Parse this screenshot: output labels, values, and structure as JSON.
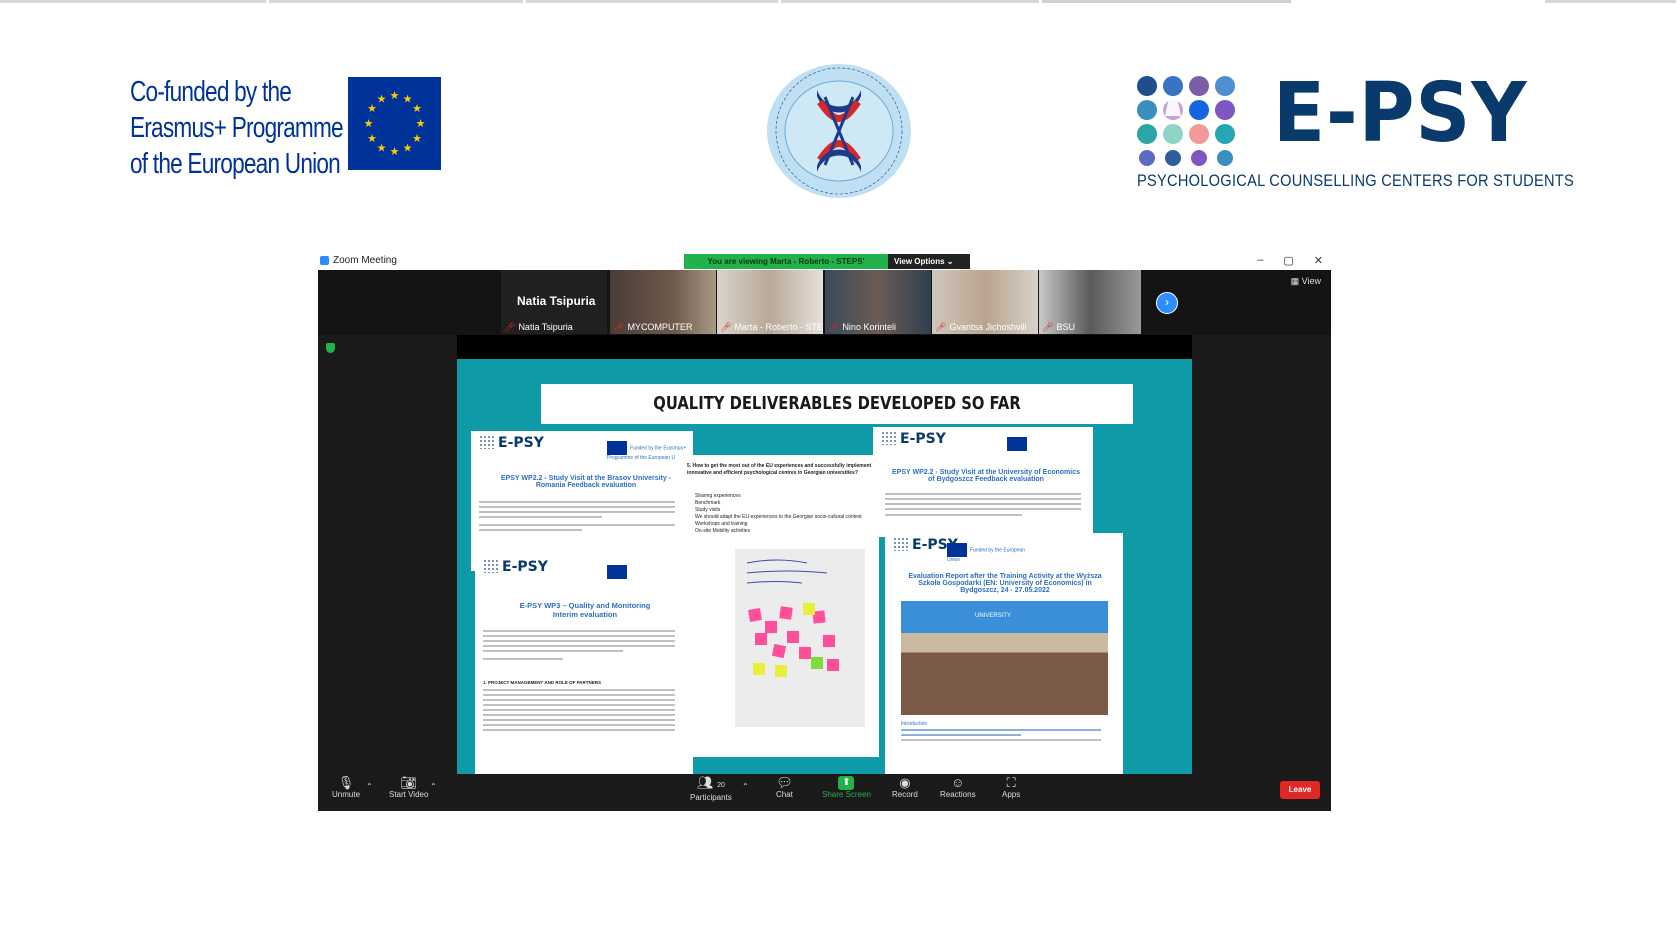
{
  "top_bar_colors": [
    "#d0d0d0",
    "#d0d0d0",
    "#d0d0d0",
    "#d0d0d0",
    "#cfcfcf",
    "#ffffff",
    "#d0d0d0"
  ],
  "eu_logo": {
    "lines": [
      "Co-funded by the",
      "Erasmus+ Programme",
      "of the European Union"
    ],
    "color": "#003399"
  },
  "university_seal": {
    "text": "Shota Meskhia State Teaching University of Zugdidi",
    "icon": "university-seal"
  },
  "epsy_logo": {
    "wordmark": "E-PSY",
    "subtitle": "PSYCHOLOGICAL COUNSELLING CENTERS FOR STUDENTS",
    "color": "#0a3a6b"
  },
  "zoom": {
    "window_title": "Zoom Meeting",
    "banner_text": "You are viewing Marta - Roberto - STEPS' screen",
    "view_options": "View Options ⌄",
    "view_label": "View",
    "window_controls": [
      "–",
      "▢",
      "✕"
    ],
    "participants": [
      {
        "label": "Natia Tsipuria",
        "display": "Natia Tsipuria",
        "muted": true
      },
      {
        "label": "MYCOMPUTER",
        "muted": true
      },
      {
        "label": "Marta - Roberto - STEPS",
        "muted": true
      },
      {
        "label": "Nino Korinteli",
        "muted": true
      },
      {
        "label": "Gvantsa Jichoshvili",
        "muted": true
      },
      {
        "label": "BSU",
        "muted": true
      }
    ],
    "controls": {
      "unmute": "Unmute",
      "start_video": "Start Video",
      "participants": "Participants",
      "participants_count": "20",
      "chat": "Chat",
      "share_screen": "Share Screen",
      "record": "Record",
      "reactions": "Reactions",
      "apps": "Apps",
      "leave": "Leave"
    },
    "shared_slide": {
      "title": "QUALITY DELIVERABLES DEVELOPED SO FAR",
      "background": "#0e9aa7",
      "docs": [
        {
          "logo": "E-PSY",
          "title": "EPSY WP2.2 - Study Visit at the Brasov University - Romania Feedback evaluation"
        },
        {
          "logo": "E-PSY",
          "title": "E-PSY WP3 – Quality and Monitoring Interim evaluation"
        },
        {
          "logo": "E-PSY",
          "title": "EPSY WP2.2 - Study Visit at the University of Economics of Bydgoszcz Feedback evaluation"
        },
        {
          "logo": "E-PSY",
          "title": "Evaluation Report after the Training Activity at the Wyższa Szkoła Gospodarki (EN: University of Economics) in Bydgoszcz, 24 - 27.05.2022"
        }
      ],
      "question": "5. How to get the most out of the EU experiences and successfully implement innovative and efficient psychological centres in Georgian universities?",
      "bullets": [
        "Sharing experiences",
        "Benchmark",
        "Study visits",
        "We should adapt the EU experiences to the Georgian socio-cultural context",
        "Workshops and training",
        "On-site Mobility activities"
      ],
      "fund_label": "Funded by the Erasmus+ Programme of the European Union",
      "fund_label_short": "Funded by the European Union",
      "section_heading": "1. PROJECT MANAGEMENT AND ROLE OF PARTNERS",
      "intro_label": "Introduction",
      "photo_sign": "UNIVERSITY"
    }
  }
}
